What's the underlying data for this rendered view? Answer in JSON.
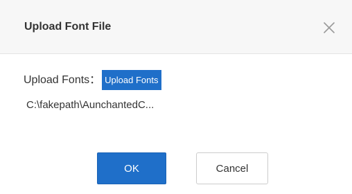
{
  "dialog": {
    "title": "Upload Font File",
    "close_icon": "close-icon"
  },
  "upload": {
    "label": "Upload Fonts：",
    "button_label": "Upload Fonts",
    "file_path": "C:\\fakepath\\AunchantedC..."
  },
  "footer": {
    "ok_label": "OK",
    "cancel_label": "Cancel"
  },
  "colors": {
    "primary": "#1f6fc9",
    "header_bg": "#f7f7f7",
    "text": "#333333"
  }
}
